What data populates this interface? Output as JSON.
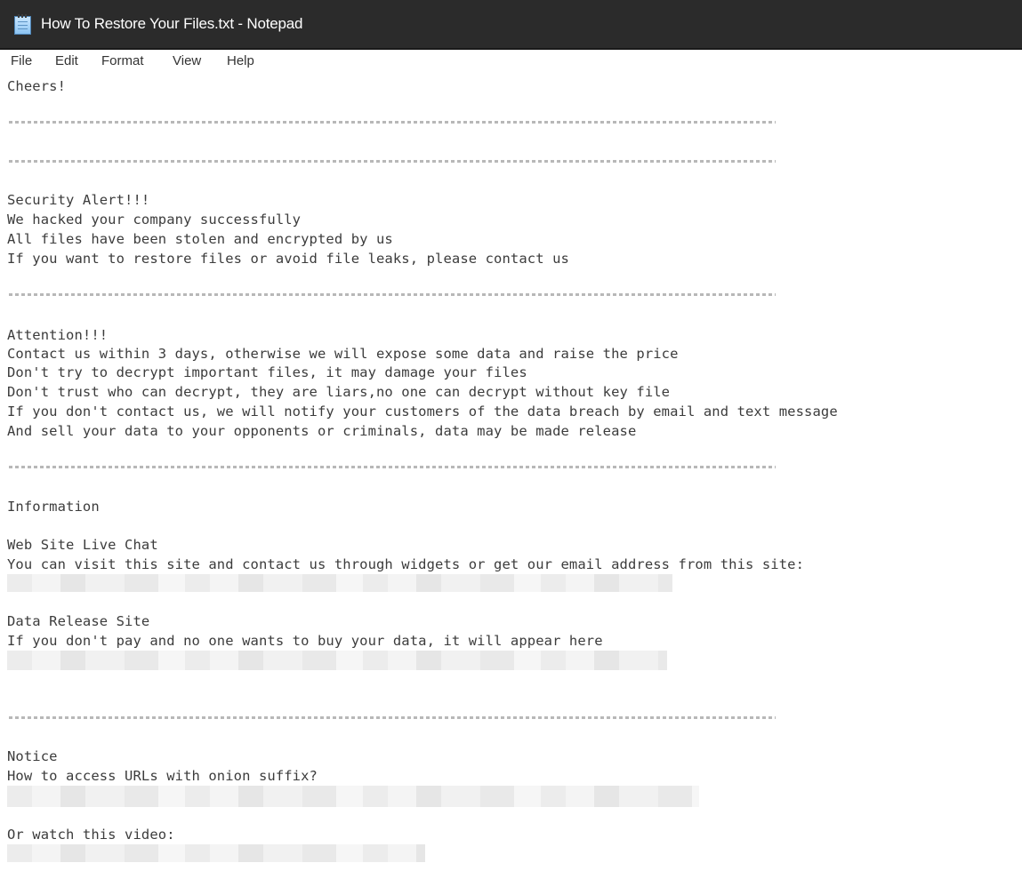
{
  "window": {
    "title": "How To Restore Your Files.txt - Notepad",
    "app_icon": "notepad-icon"
  },
  "menu": {
    "file": "File",
    "edit": "Edit",
    "format": "Format",
    "view": "View",
    "help": "Help"
  },
  "document": {
    "greeting": "Cheers!",
    "security_heading": "Security Alert!!!",
    "security_line_1": "We hacked your company successfully",
    "security_line_2": "All files have been stolen and encrypted by us",
    "security_line_3": "If you want to restore files or avoid file leaks, please contact us",
    "attention_heading": "Attention!!!",
    "attention_line_1": "Contact us within 3 days, otherwise we will expose some data and raise the price",
    "attention_line_2": "Don't try to decrypt important files, it may damage your files",
    "attention_line_3": "Don't trust who can decrypt, they are liars,no one can decrypt without key file",
    "attention_line_4": "If you don't contact us, we will notify your customers of the data breach by email and text message",
    "attention_line_5": "And sell your data to your opponents or criminals, data may be made release",
    "information_heading": "Information",
    "web_chat_heading": "Web Site Live Chat",
    "web_chat_line": "You can visit this site and contact us through widgets or get our email address from this site:",
    "release_heading": "Data Release Site",
    "release_line": "If you don't pay and no one wants to buy your data, it will appear here",
    "notice_heading": "Notice",
    "notice_line": "How to access URLs with onion suffix?",
    "video_line": "Or watch this video:"
  }
}
